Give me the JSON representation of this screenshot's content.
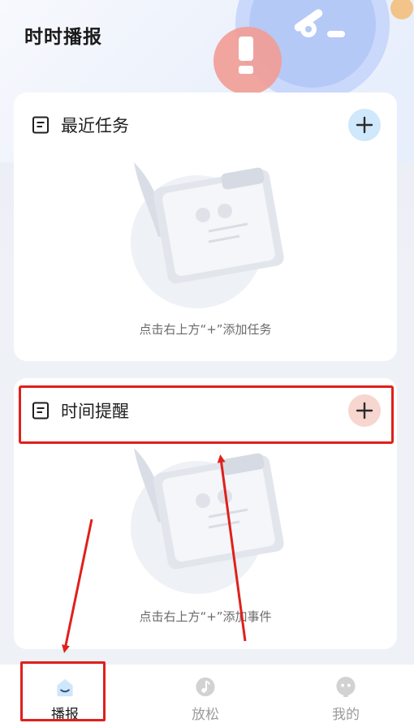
{
  "app": {
    "title": "时时播报"
  },
  "cards": [
    {
      "title": "最近任务",
      "empty_text": "点击右上方“+”添加任务",
      "add_color": "#cfe8fb"
    },
    {
      "title": "时间提醒",
      "empty_text": "点击右上方“+”添加事件",
      "add_color": "#f7d6d0"
    }
  ],
  "tabbar": {
    "tabs": [
      {
        "label": "播报",
        "icon": "home-icon",
        "active": true
      },
      {
        "label": "放松",
        "icon": "music-icon",
        "active": false
      },
      {
        "label": "我的",
        "icon": "profile-icon",
        "active": false
      }
    ]
  },
  "colors": {
    "highlight": "#e0201c",
    "accent_blue": "#cfe8fb",
    "accent_pink": "#f7d6d0"
  }
}
